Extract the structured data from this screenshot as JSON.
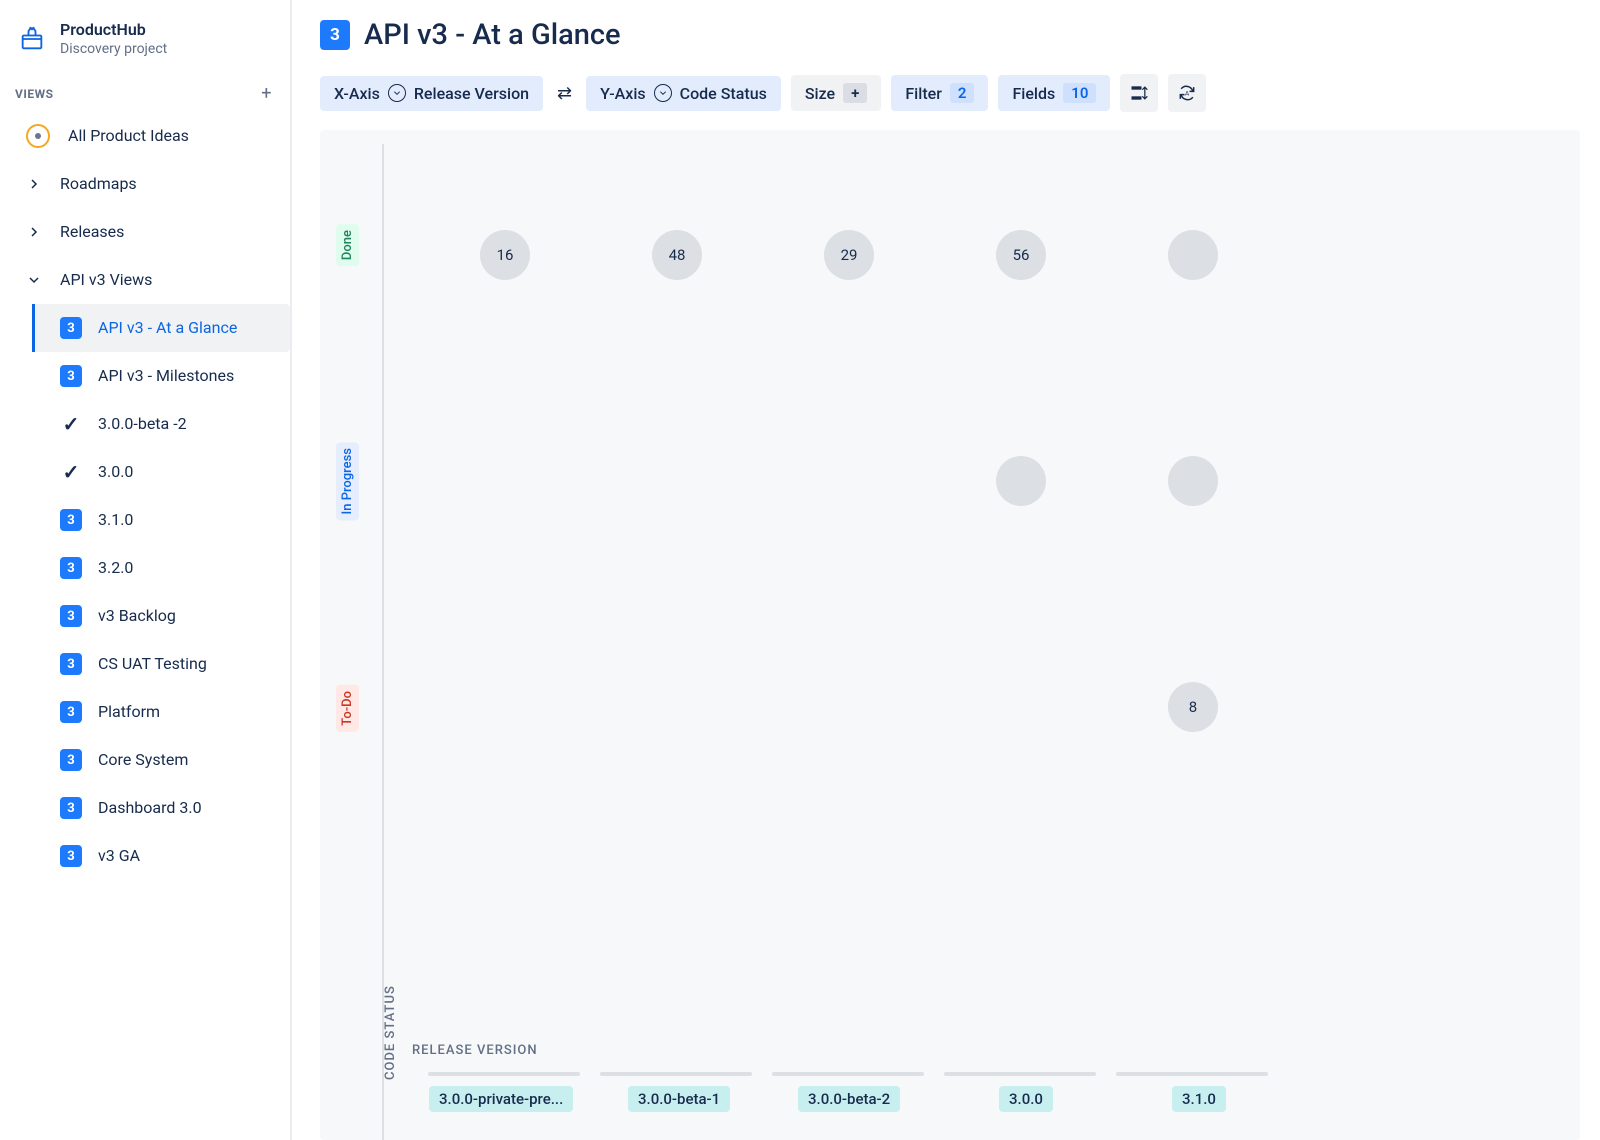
{
  "project": {
    "title": "ProductHub",
    "subtitle": "Discovery project"
  },
  "views_header": "VIEWS",
  "nav": {
    "all_ideas": "All Product Ideas",
    "roadmaps": "Roadmaps",
    "releases": "Releases",
    "api_views": "API v3 Views",
    "items": [
      "API v3 - At a Glance",
      "API v3 - Milestones",
      "3.0.0-beta -2",
      "3.0.0",
      "3.1.0",
      "3.2.0",
      "v3 Backlog",
      "CS UAT Testing",
      "Platform",
      "Core System",
      "Dashboard 3.0",
      "v3 GA"
    ]
  },
  "badge3": "3",
  "page": {
    "title": "API v3 - At a Glance"
  },
  "toolbar": {
    "xaxis_label": "X-Axis",
    "xaxis_value": "Release Version",
    "yaxis_label": "Y-Axis",
    "yaxis_value": "Code Status",
    "size_label": "Size",
    "filter_label": "Filter",
    "filter_count": "2",
    "fields_label": "Fields",
    "fields_count": "10",
    "plus": "+"
  },
  "chart_data": {
    "type": "scatter",
    "xlabel": "RELEASE VERSION",
    "ylabel": "CODE STATUS",
    "x_categories": [
      "3.0.0-private-pre...",
      "3.0.0-beta-1",
      "3.0.0-beta-2",
      "3.0.0",
      "3.1.0"
    ],
    "y_categories": [
      "Done",
      "In Progress",
      "To-Do"
    ],
    "points": [
      {
        "y": "Done",
        "x": "3.0.0-private-pre...",
        "value": 16
      },
      {
        "y": "Done",
        "x": "3.0.0-beta-1",
        "value": 48
      },
      {
        "y": "Done",
        "x": "3.0.0-beta-2",
        "value": 29
      },
      {
        "y": "Done",
        "x": "3.0.0",
        "value": 56
      },
      {
        "y": "Done",
        "x": "3.1.0",
        "value": null
      },
      {
        "y": "In Progress",
        "x": "3.0.0",
        "value": null
      },
      {
        "y": "In Progress",
        "x": "3.1.0",
        "value": null
      },
      {
        "y": "To-Do",
        "x": "3.1.0",
        "value": 8
      }
    ]
  }
}
